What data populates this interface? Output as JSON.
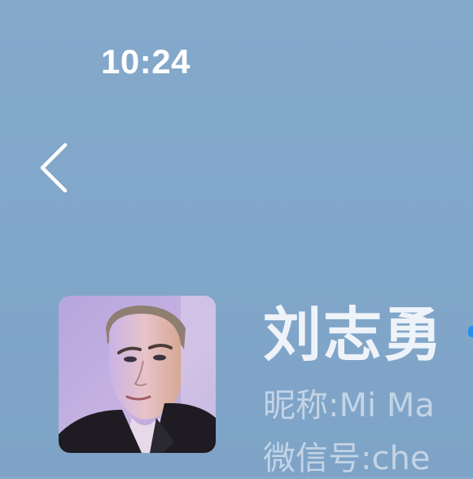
{
  "status_bar": {
    "time": "10:24"
  },
  "nav": {
    "back_icon": "chevron-left-icon"
  },
  "profile": {
    "name": "刘志勇",
    "nickname_label": "昵称",
    "nickname_sep": ":",
    "nickname_value": "Mi Ma",
    "wechat_label": "微信号",
    "wechat_sep": ":",
    "wechat_value": "che"
  },
  "colors": {
    "background": "#82a7ca",
    "secondary_text": "#c3d4e6",
    "accent": "#2b8cf0"
  }
}
